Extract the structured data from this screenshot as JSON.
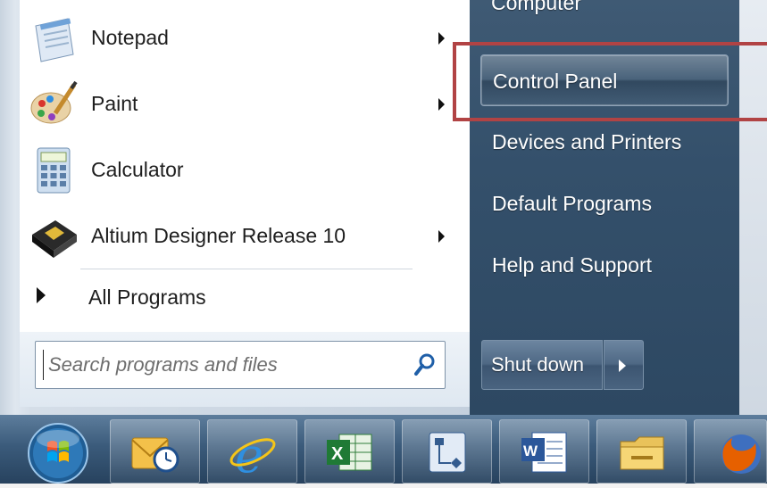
{
  "programs": [
    {
      "label": "Notepad",
      "icon": "notepad-icon",
      "has_submenu": true
    },
    {
      "label": "Paint",
      "icon": "paint-icon",
      "has_submenu": true
    },
    {
      "label": "Calculator",
      "icon": "calculator-icon",
      "has_submenu": false
    },
    {
      "label": "Altium Designer Release 10",
      "icon": "altium-designer-icon",
      "has_submenu": true
    }
  ],
  "all_programs": {
    "label": "All Programs"
  },
  "search": {
    "placeholder": "Search programs and files",
    "value": ""
  },
  "right_pane": {
    "computer": "Computer",
    "items": [
      {
        "label": "Control Panel",
        "highlighted": true
      },
      {
        "label": "Devices and Printers",
        "highlighted": false
      },
      {
        "label": "Default Programs",
        "highlighted": false
      },
      {
        "label": "Help and Support",
        "highlighted": false
      }
    ]
  },
  "shutdown": {
    "label": "Shut down"
  },
  "taskbar": {
    "items": [
      "start-orb-icon",
      "outlook-icon",
      "internet-explorer-icon",
      "excel-icon",
      "visio-icon",
      "word-icon",
      "file-explorer-icon",
      "firefox-icon"
    ]
  },
  "colors": {
    "highlight_outline": "#b14344",
    "right_pane": "#34506b",
    "taskbar": "#3b5b7b"
  }
}
